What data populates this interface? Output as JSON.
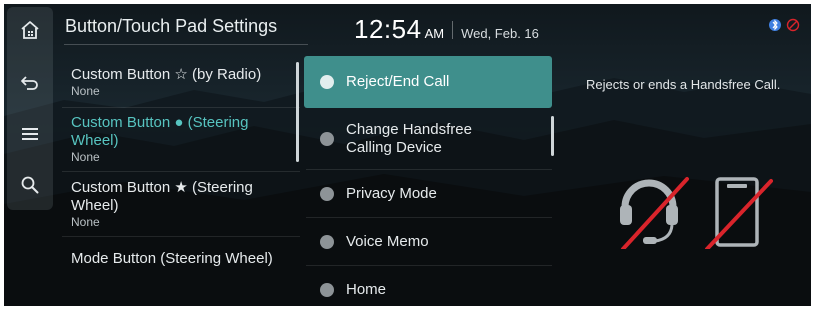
{
  "header": {
    "title": "Button/Touch Pad Settings",
    "time": "12:54",
    "ampm": "AM",
    "date": "Wed, Feb. 16"
  },
  "sidebar": {
    "items": [
      {
        "icon": "home-icon"
      },
      {
        "icon": "back-icon"
      },
      {
        "icon": "menu-icon"
      },
      {
        "icon": "search-icon"
      }
    ]
  },
  "status_icons": [
    "bluetooth-phone-icon",
    "mute-icon"
  ],
  "buttons": [
    {
      "label": "Custom Button ☆ (by Radio)",
      "value": "None"
    },
    {
      "label": "Custom Button ● (Steering Wheel)",
      "value": "None"
    },
    {
      "label": "Custom Button ★ (Steering Wheel)",
      "value": "None"
    },
    {
      "label": "Mode Button (Steering Wheel)",
      "value": ""
    }
  ],
  "options": [
    {
      "label": "Reject/End Call",
      "selected": true
    },
    {
      "label": "Change Handsfree Calling Device",
      "selected": false
    },
    {
      "label": "Privacy Mode",
      "selected": false
    },
    {
      "label": "Voice Memo",
      "selected": false
    },
    {
      "label": "Home",
      "selected": false
    }
  ],
  "description": "Rejects or ends a Handsfree Call.",
  "colors": {
    "accent": "#57c4c0",
    "selected_bg": "#3f8f8c",
    "strike": "#d9242b"
  }
}
